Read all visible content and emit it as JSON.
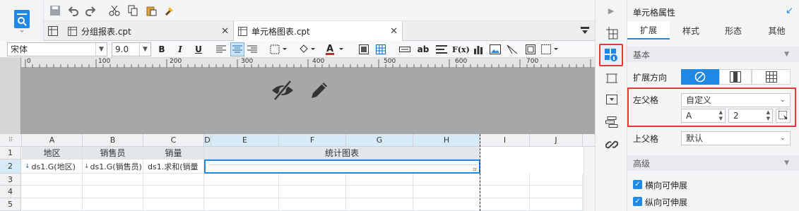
{
  "toolbar": {
    "tabs": [
      {
        "label": "分组报表.cpt",
        "active": false
      },
      {
        "label": "单元格图表.cpt",
        "active": true
      }
    ]
  },
  "format_bar": {
    "font_name": "宋体",
    "font_size": "9.0",
    "bold": "B",
    "italic": "I",
    "underline": "U",
    "text_btn": "ab",
    "formula_btn": "F(x)"
  },
  "ruler": {
    "ticks": [
      "0",
      "100",
      "200",
      "300",
      "400",
      "500",
      "600",
      "700"
    ]
  },
  "grid": {
    "col_headers": [
      "A",
      "B",
      "C",
      "D",
      "E",
      "F",
      "G",
      "H",
      "I",
      "J"
    ],
    "row_headers": [
      "1",
      "2",
      "3",
      "4",
      "5"
    ],
    "row1": [
      "地区",
      "销售员",
      "销量",
      "统计图表"
    ],
    "row2": [
      "ds1.G(地区)",
      "ds1.G(销售员)",
      "ds1.求和(销量"
    ]
  },
  "panel": {
    "title": "单元格属性",
    "tabs": [
      "扩展",
      "样式",
      "形态",
      "其他"
    ],
    "section_basic": "基本",
    "expand_direction_label": "扩展方向",
    "left_parent_label": "左父格",
    "left_parent_value": "自定义",
    "left_parent_col": "A",
    "left_parent_row": "2",
    "up_parent_label": "上父格",
    "up_parent_value": "默认",
    "section_advanced": "高级",
    "horizontal_extend": "横向可伸展",
    "vertical_extend": "纵向可伸展"
  },
  "colors": {
    "accent": "#1e88e5",
    "highlight_red": "#e53935",
    "selected_col": "#d6ebf7"
  }
}
